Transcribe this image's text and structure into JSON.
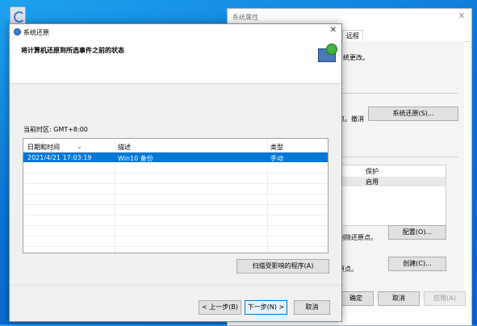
{
  "desktop": {
    "icon": "recycle-bin-icon"
  },
  "props_dialog": {
    "title": "系统属性",
    "tab_label": "远程",
    "text_changes": "统更改。",
    "text_undo": "点。撤消",
    "system_restore_button": "系统还原(S)...",
    "table_header": "保护",
    "table_row_value": "启用",
    "text_delete_points": "删除还原点。",
    "configure_button": "配置(O)...",
    "text_create_point": "原点。",
    "create_button": "创建(C)...",
    "ok_button": "确定",
    "cancel_button": "取消",
    "apply_button": "应用(A)"
  },
  "restore_dialog": {
    "title": "系统还原",
    "heading": "将计算机还原到所选事件之前的状态",
    "timezone": "当前时区: GMT+8:00",
    "columns": [
      "日期和时间",
      "描述",
      "类型"
    ],
    "rows": [
      {
        "date": "2021/4/21 17:03:19",
        "desc": "Win10 备份",
        "type": "手动"
      }
    ],
    "scan_button": "扫描受影响的程序(A)",
    "back_button": "< 上一步(B)",
    "next_button": "下一步(N) >",
    "cancel_button": "取消"
  },
  "colors": {
    "accent": "#0078d7",
    "desktop": "#0a74d6"
  }
}
